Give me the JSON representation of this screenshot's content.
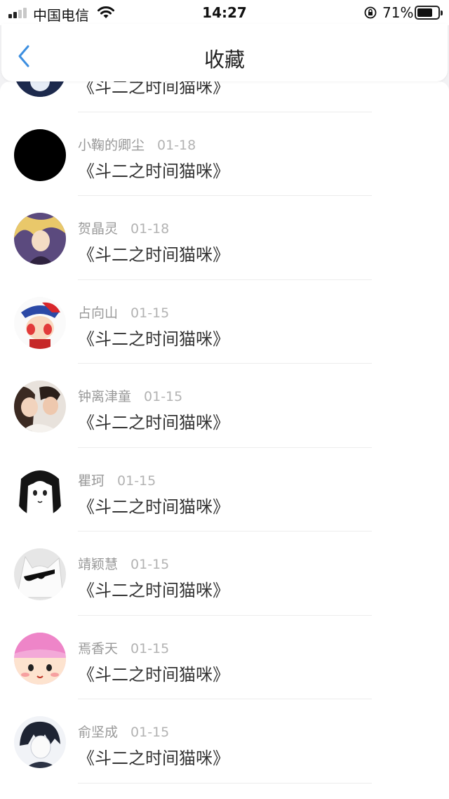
{
  "status": {
    "carrier": "中国电信",
    "time": "14:27",
    "battery_pct": "71%"
  },
  "nav": {
    "title": "收藏"
  },
  "colors": {
    "accent": "#3d8fe0",
    "meta": "#999999",
    "title": "#333333"
  },
  "items": [
    {
      "user": "",
      "date": "",
      "title": "《斗二之时间猫咪》",
      "avatar": "dark-anime"
    },
    {
      "user": "小鞠的卿尘",
      "date": "01-18",
      "title": "《斗二之时间猫咪》",
      "avatar": "black"
    },
    {
      "user": "贺晶灵",
      "date": "01-18",
      "title": "《斗二之时间猫咪》",
      "avatar": "blonde-anime"
    },
    {
      "user": "占向山",
      "date": "01-15",
      "title": "《斗二之时间猫咪》",
      "avatar": "cartoon-boy"
    },
    {
      "user": "钟离津童",
      "date": "01-15",
      "title": "《斗二之时间猫咪》",
      "avatar": "couple-photo"
    },
    {
      "user": "瞿珂",
      "date": "01-15",
      "title": "《斗二之时间猫咪》",
      "avatar": "manga-girl"
    },
    {
      "user": "靖颖慧",
      "date": "01-15",
      "title": "《斗二之时间猫咪》",
      "avatar": "sunglasses-cat"
    },
    {
      "user": "焉香天",
      "date": "01-15",
      "title": "《斗二之时间猫咪》",
      "avatar": "pink-cartoon"
    },
    {
      "user": "俞坚成",
      "date": "01-15",
      "title": "《斗二之时间猫咪》",
      "avatar": "sketch-boy"
    }
  ]
}
